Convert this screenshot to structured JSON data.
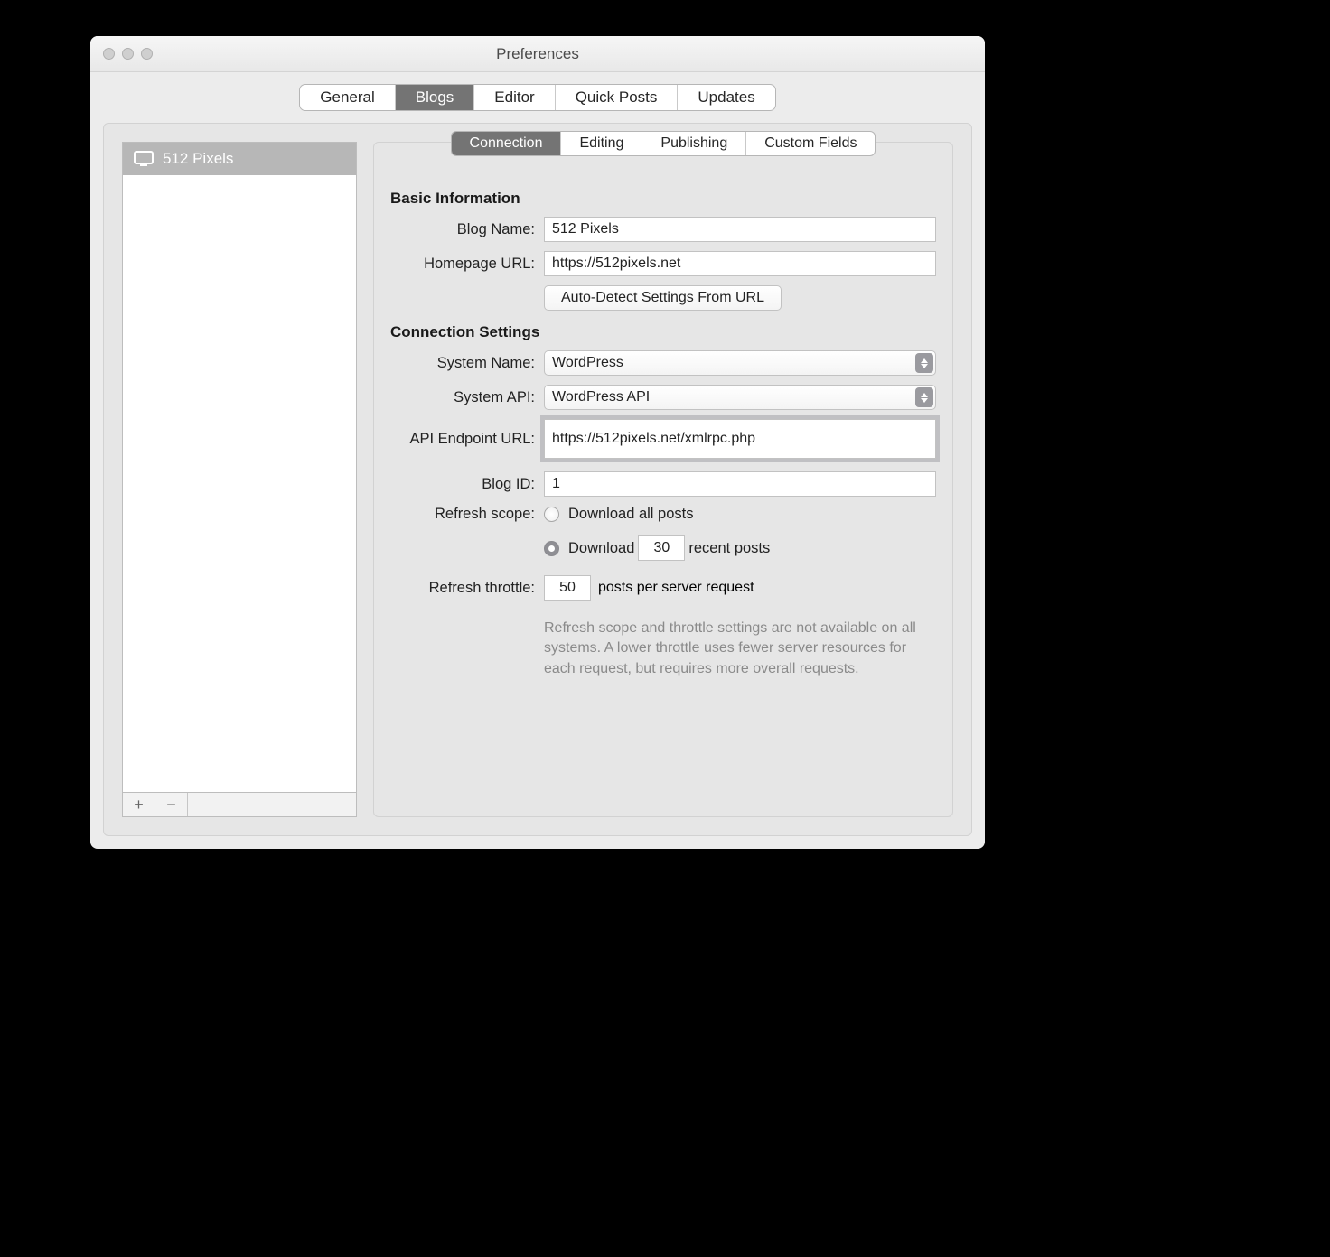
{
  "window_title": "Preferences",
  "main_tabs": [
    "General",
    "Blogs",
    "Editor",
    "Quick Posts",
    "Updates"
  ],
  "main_tab_selected": "Blogs",
  "sidebar": {
    "items": [
      {
        "label": "512 Pixels"
      }
    ]
  },
  "subtabs": [
    "Connection",
    "Editing",
    "Publishing",
    "Custom Fields"
  ],
  "subtab_selected": "Connection",
  "sections": {
    "basic_title": "Basic Information",
    "connection_title": "Connection Settings"
  },
  "labels": {
    "blog_name": "Blog Name:",
    "homepage_url": "Homepage URL:",
    "autodetect_btn": "Auto-Detect Settings From URL",
    "system_name": "System Name:",
    "system_api": "System API:",
    "api_endpoint": "API Endpoint URL:",
    "blog_id": "Blog ID:",
    "refresh_scope": "Refresh scope:",
    "refresh_throttle": "Refresh throttle:",
    "download_all": "Download all posts",
    "download_prefix": "Download",
    "download_suffix": "recent posts",
    "throttle_suffix": "posts per server request"
  },
  "values": {
    "blog_name": "512 Pixels",
    "homepage_url": "https://512pixels.net",
    "system_name": "WordPress",
    "system_api": "WordPress API",
    "api_endpoint": "https://512pixels.net/xmlrpc.php",
    "blog_id": "1",
    "recent_count": "30",
    "throttle_count": "50",
    "scope_selected": "recent"
  },
  "help_text": "Refresh scope and throttle settings are not available on all systems. A lower throttle uses fewer server resources for each request, but requires more overall requests."
}
